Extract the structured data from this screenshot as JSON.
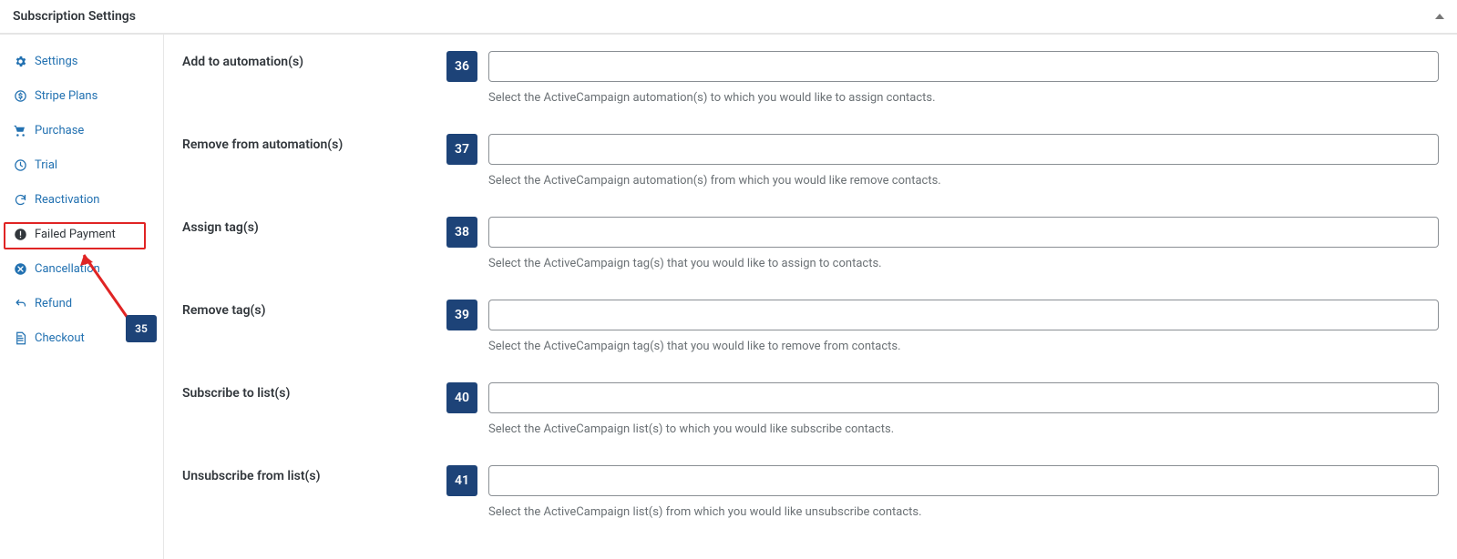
{
  "header": {
    "title": "Subscription Settings"
  },
  "sidebar": {
    "items": [
      {
        "label": "Settings"
      },
      {
        "label": "Stripe Plans"
      },
      {
        "label": "Purchase"
      },
      {
        "label": "Trial"
      },
      {
        "label": "Reactivation"
      },
      {
        "label": "Failed Payment"
      },
      {
        "label": "Cancellation"
      },
      {
        "label": "Refund"
      },
      {
        "label": "Checkout"
      }
    ],
    "annotation_badge": "35"
  },
  "fields": [
    {
      "label": "Add to automation(s)",
      "badge": "36",
      "help": "Select the ActiveCampaign automation(s) to which you would like to assign contacts."
    },
    {
      "label": "Remove from automation(s)",
      "badge": "37",
      "help": "Select the ActiveCampaign automation(s) from which you would like remove contacts."
    },
    {
      "label": "Assign tag(s)",
      "badge": "38",
      "help": "Select the ActiveCampaign tag(s) that you would like to assign to contacts."
    },
    {
      "label": "Remove tag(s)",
      "badge": "39",
      "help": "Select the ActiveCampaign tag(s) that you would like to remove from contacts."
    },
    {
      "label": "Subscribe to list(s)",
      "badge": "40",
      "help": "Select the ActiveCampaign list(s) to which you would like subscribe contacts."
    },
    {
      "label": "Unsubscribe from list(s)",
      "badge": "41",
      "help": "Select the ActiveCampaign list(s) from which you would like unsubscribe contacts."
    }
  ]
}
